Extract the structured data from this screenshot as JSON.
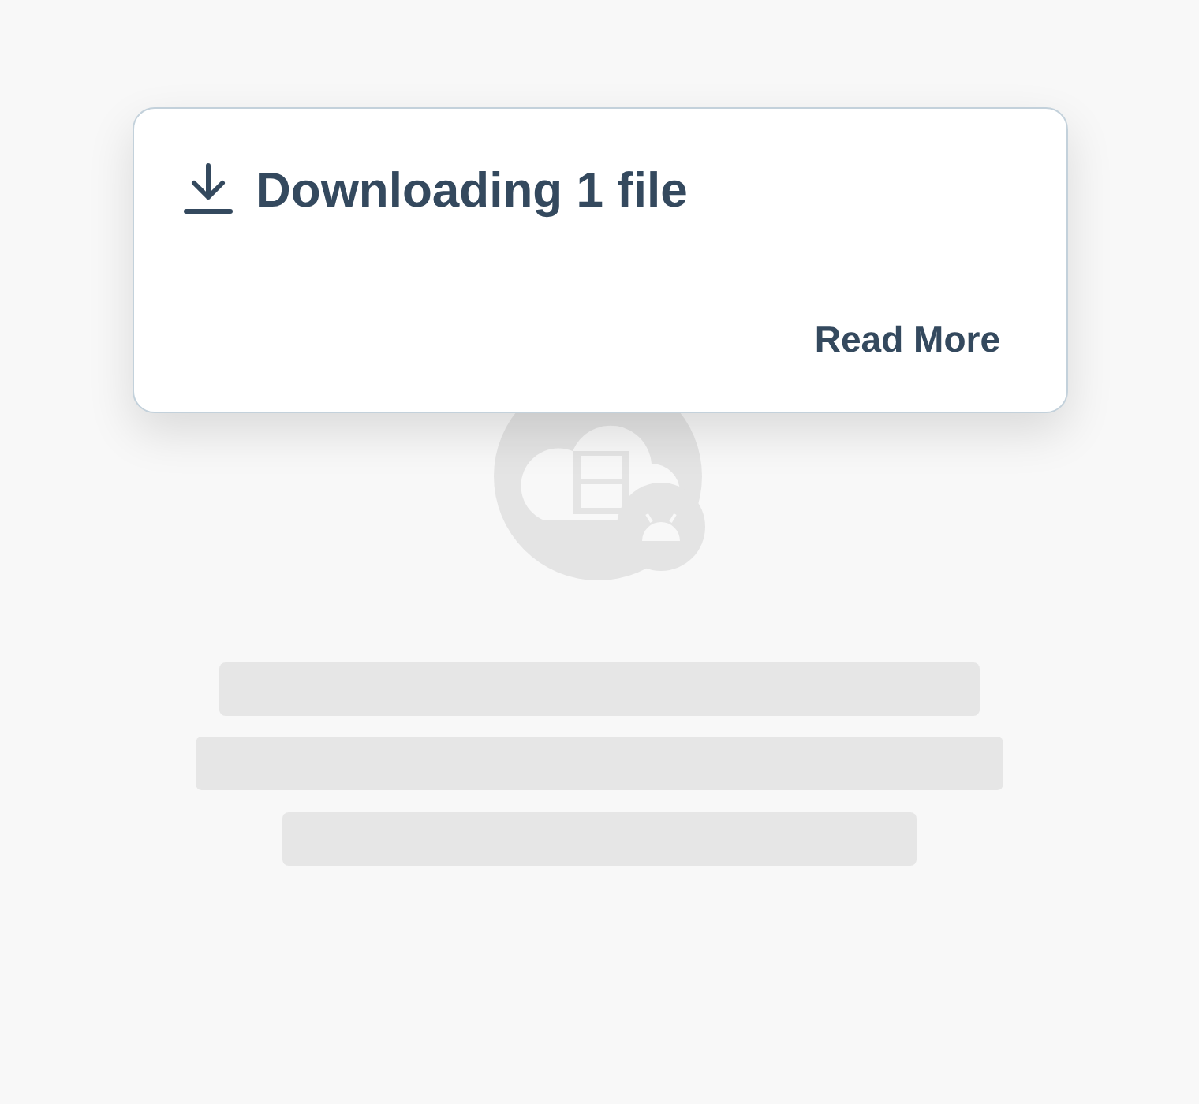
{
  "notification": {
    "title": "Downloading 1 file",
    "link": "Read More"
  }
}
